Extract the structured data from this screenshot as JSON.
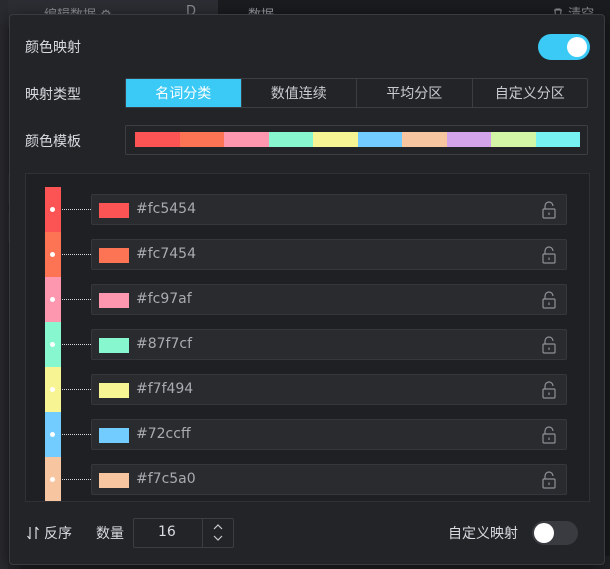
{
  "background": {
    "left_panel_title": "编辑数据 ⚙",
    "left_panel_button": "D",
    "right_panel_title": "数据",
    "clear_label": "清空",
    "clear_icon": "trash-icon"
  },
  "dialog": {
    "color_mapping_label": "颜色映射",
    "color_mapping_enabled": true,
    "mapping_type_label": "映射类型",
    "mapping_types": [
      {
        "label": "名词分类",
        "active": true
      },
      {
        "label": "数值连续",
        "active": false
      },
      {
        "label": "平均分区",
        "active": false
      },
      {
        "label": "自定义分区",
        "active": false
      }
    ],
    "color_template_label": "颜色模板",
    "template_colors": [
      "#fc5454",
      "#fc7454",
      "#fc97af",
      "#87f7cf",
      "#f7f494",
      "#72ccff",
      "#f7c5a0",
      "#d4a4eb",
      "#d2f5a6",
      "#76f2f2"
    ],
    "colors": [
      {
        "hex": "#fc5454",
        "lock_icon": "lock-icon"
      },
      {
        "hex": "#fc7454",
        "lock_icon": "lock-icon"
      },
      {
        "hex": "#fc97af",
        "lock_icon": "lock-icon"
      },
      {
        "hex": "#87f7cf",
        "lock_icon": "lock-icon"
      },
      {
        "hex": "#f7f494",
        "lock_icon": "lock-icon"
      },
      {
        "hex": "#72ccff",
        "lock_icon": "lock-icon"
      },
      {
        "hex": "#f7c5a0",
        "lock_icon": "lock-icon"
      }
    ],
    "reverse_label": "反序",
    "reverse_icon": "sort-arrows-icon",
    "count_label": "数量",
    "count_value": "16",
    "custom_mapping_label": "自定义映射",
    "custom_mapping_enabled": false,
    "accent_color": "#3bc9f5"
  }
}
